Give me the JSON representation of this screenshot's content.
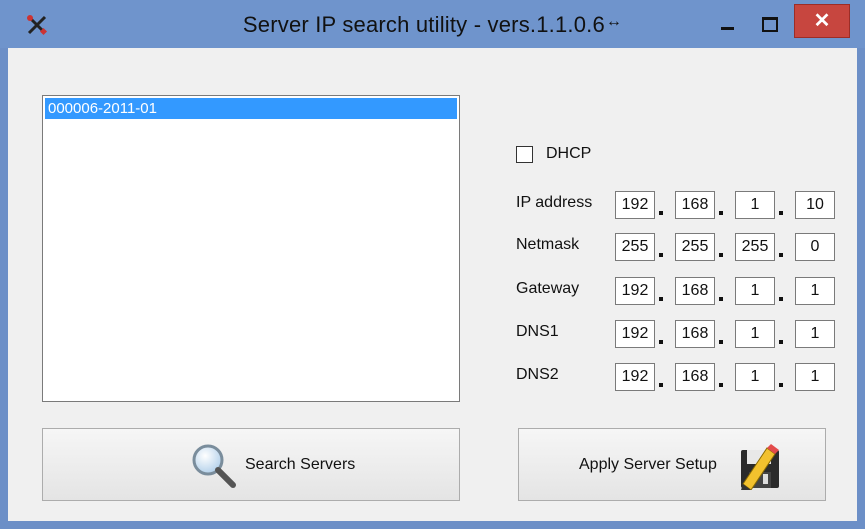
{
  "window": {
    "title": "Server IP search utility - vers.1.1.0.6",
    "title_suffix": "↔"
  },
  "titlebar_buttons": {
    "close": "✕"
  },
  "server_list": {
    "items": [
      "000006-2011-01"
    ]
  },
  "dhcp": {
    "label": "DHCP",
    "checked": false
  },
  "network": {
    "rows": [
      {
        "label": "IP address",
        "octets": [
          "192",
          "168",
          "1",
          "10"
        ]
      },
      {
        "label": "Netmask",
        "octets": [
          "255",
          "255",
          "255",
          "0"
        ]
      },
      {
        "label": "Gateway",
        "octets": [
          "192",
          "168",
          "1",
          "1"
        ]
      },
      {
        "label": "DNS1",
        "octets": [
          "192",
          "168",
          "1",
          "1"
        ]
      },
      {
        "label": "DNS2",
        "octets": [
          "192",
          "168",
          "1",
          "1"
        ]
      }
    ]
  },
  "buttons": {
    "search": "Search Servers",
    "apply": "Apply Server Setup"
  },
  "colors": {
    "titlebar": "#6f94cc",
    "close": "#c7463f",
    "selection": "#3399ff"
  },
  "icons": {
    "app": "tools-icon",
    "search": "magnifier-icon",
    "apply": "floppy-pencil-icon"
  }
}
